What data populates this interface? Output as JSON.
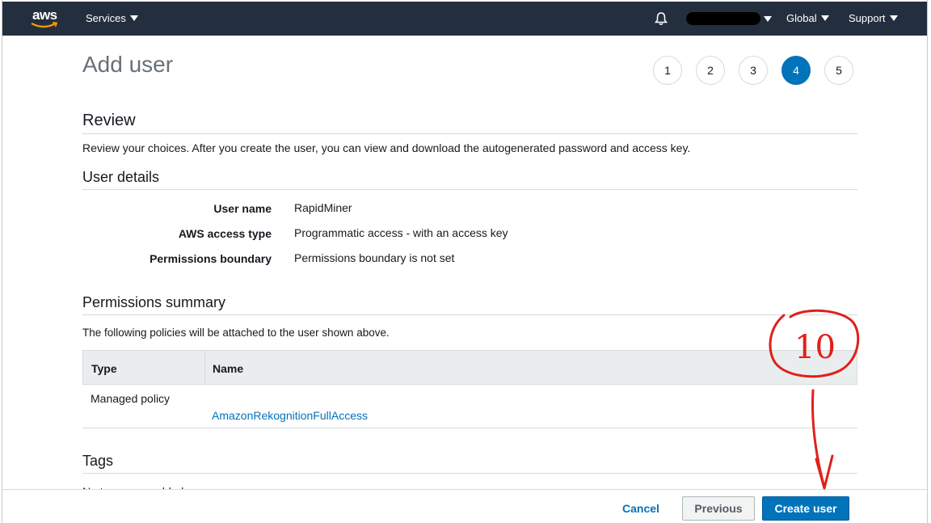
{
  "topnav": {
    "logo_text": "aws",
    "services_label": "Services",
    "region_label": "Global",
    "support_label": "Support"
  },
  "page": {
    "title": "Add user",
    "steps": [
      "1",
      "2",
      "3",
      "4",
      "5"
    ],
    "active_step": "4"
  },
  "review": {
    "heading": "Review",
    "description": "Review your choices. After you create the user, you can view and download the autogenerated password and access key."
  },
  "user_details": {
    "heading": "User details",
    "rows": [
      {
        "label": "User name",
        "value": "RapidMiner"
      },
      {
        "label": "AWS access type",
        "value": "Programmatic access - with an access key"
      },
      {
        "label": "Permissions boundary",
        "value": "Permissions boundary is not set"
      }
    ]
  },
  "permissions": {
    "heading": "Permissions summary",
    "description": "The following policies will be attached to the user shown above.",
    "columns": [
      "Type",
      "Name"
    ],
    "rows": [
      {
        "type": "Managed policy",
        "name": "AmazonRekognitionFullAccess"
      }
    ]
  },
  "tags": {
    "heading": "Tags",
    "partial_text": "No tags were added."
  },
  "footer": {
    "cancel_label": "Cancel",
    "previous_label": "Previous",
    "create_label": "Create user"
  },
  "annotation": {
    "label": "10",
    "color": "#e0201b"
  },
  "colors": {
    "nav_bg": "#232f3e",
    "primary": "#0073bb",
    "link": "#0073bb"
  }
}
